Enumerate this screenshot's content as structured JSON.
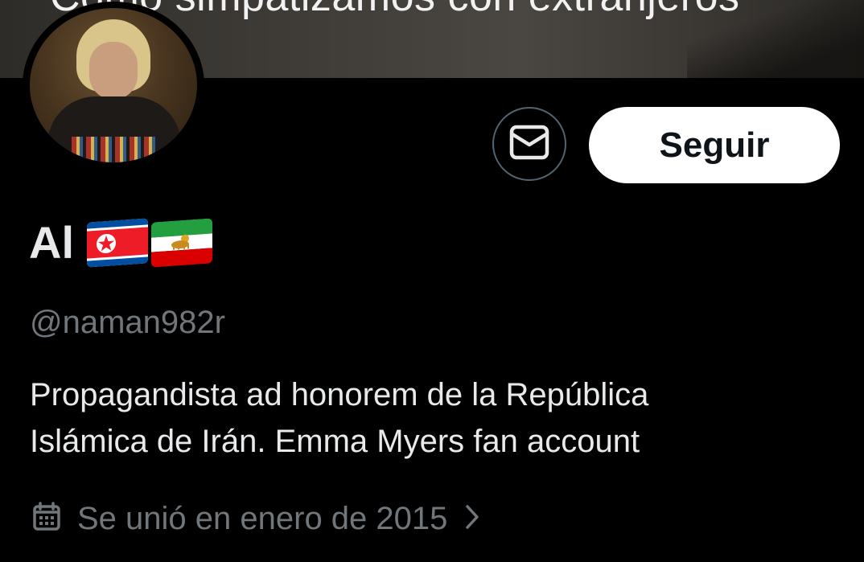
{
  "banner": {
    "caption": "Como simpatizamos con extranjeros"
  },
  "avatar": {
    "label": "Profile photo"
  },
  "actions": {
    "message_icon": "mail-icon",
    "follow_label": "Seguir"
  },
  "profile": {
    "display_name": "Al",
    "flags": [
      "north-korea-flag",
      "iran-lion-and-sun-flag"
    ],
    "handle": "@naman982r",
    "bio_lines": [
      "Propagandista ad honorem de la República",
      "Islámica de Irán. Emma Myers fan account"
    ],
    "joined": "Se unió en enero de 2015",
    "joined_icon": "calendar-icon",
    "joined_chevron": "chevron-right-icon"
  },
  "colors": {
    "background": "#000000",
    "primary_text": "#e7e9ea",
    "secondary_text": "#71767b",
    "button_bg": "#ffffff",
    "button_text": "#0f1419",
    "outline": "#536471"
  }
}
